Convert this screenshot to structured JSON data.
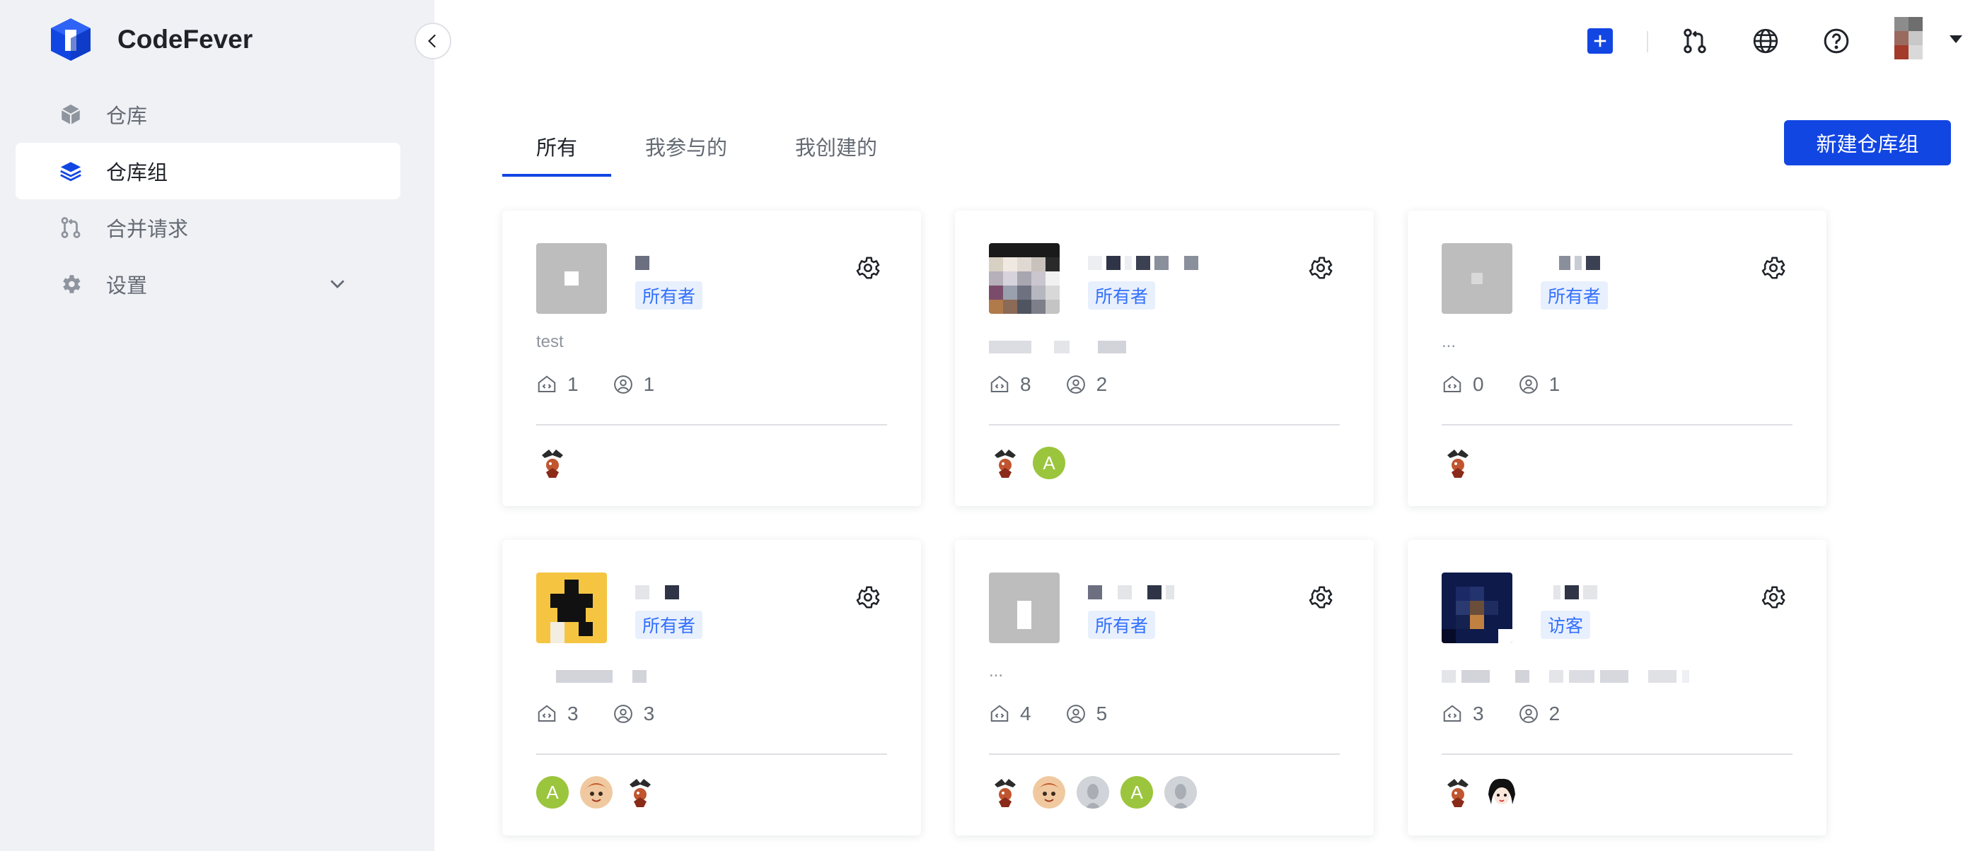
{
  "app": {
    "name": "CodeFever",
    "brand_color": "#1246e3"
  },
  "sidebar": {
    "items": [
      {
        "label": "仓库",
        "icon": "cube-icon",
        "active": false
      },
      {
        "label": "仓库组",
        "icon": "layers-icon",
        "active": true
      },
      {
        "label": "合并请求",
        "icon": "merge-request-icon",
        "active": false
      },
      {
        "label": "设置",
        "icon": "gear-icon",
        "active": false,
        "expandable": true
      }
    ]
  },
  "topbar": {
    "icons": [
      "plus-icon",
      "merge-request-icon",
      "globe-icon",
      "help-icon",
      "user-avatar",
      "caret-down-icon"
    ]
  },
  "tabs": [
    {
      "label": "所有",
      "active": true
    },
    {
      "label": "我参与的",
      "active": false
    },
    {
      "label": "我创建的",
      "active": false
    }
  ],
  "actions": {
    "new_group": "新建仓库组"
  },
  "cards": [
    {
      "role": "所有者",
      "description": "test",
      "repos": "1",
      "members": "1",
      "avatars": [
        "mascot"
      ]
    },
    {
      "role": "所有者",
      "description": "",
      "repos": "8",
      "members": "2",
      "avatars": [
        "mascot",
        "A"
      ]
    },
    {
      "role": "所有者",
      "description": "...",
      "repos": "0",
      "members": "1",
      "avatars": [
        "mascot"
      ]
    },
    {
      "role": "所有者",
      "description": "",
      "repos": "3",
      "members": "3",
      "avatars": [
        "A",
        "cartoon",
        "mascot"
      ]
    },
    {
      "role": "所有者",
      "description": "...",
      "repos": "4",
      "members": "5",
      "avatars": [
        "mascot",
        "cartoon",
        "gray",
        "A",
        "gray"
      ]
    },
    {
      "role": "访客",
      "description": "",
      "repos": "3",
      "members": "2",
      "avatars": [
        "mascot",
        "girl"
      ]
    }
  ]
}
